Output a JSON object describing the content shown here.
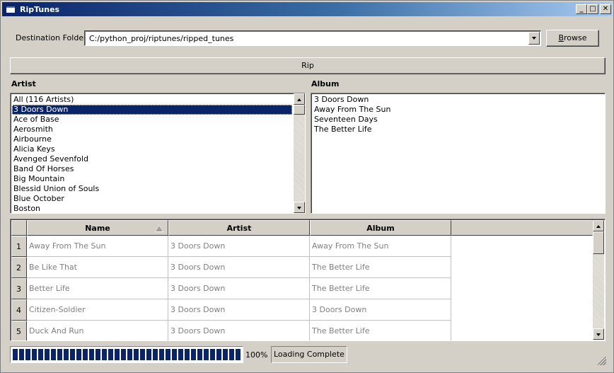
{
  "window": {
    "title": "RipTunes",
    "minimize_glyph": "_",
    "maximize_glyph": "□",
    "close_glyph": "✕"
  },
  "destination": {
    "label": "Destination Folder:",
    "value": "C:/python_proj/riptunes/ripped_tunes",
    "browse_label_prefix": "B",
    "browse_label_rest": "rowse"
  },
  "rip": {
    "label": "Rip"
  },
  "artist": {
    "label": "Artist",
    "items": [
      "All (116 Artists)",
      "3 Doors Down",
      "Ace of Base",
      "Aerosmith",
      "Airbourne",
      "Alicia Keys",
      "Avenged Sevenfold",
      "Band Of Horses",
      "Big Mountain",
      "Blessid Union of Souls",
      "Blue October",
      "Boston"
    ],
    "selected_index": 1
  },
  "album": {
    "label": "Album",
    "items": [
      "3 Doors Down",
      "Away From The Sun",
      "Seventeen Days",
      "The Better Life"
    ]
  },
  "table": {
    "columns": [
      "Name",
      "Artist",
      "Album"
    ],
    "sort_column": "Name",
    "rows": [
      {
        "num": "1",
        "name": "Away From The Sun",
        "artist": "3 Doors Down",
        "album": "Away From The Sun"
      },
      {
        "num": "2",
        "name": "Be Like That",
        "artist": "3 Doors Down",
        "album": "The Better Life"
      },
      {
        "num": "3",
        "name": "Better Life",
        "artist": "3 Doors Down",
        "album": "The Better Life"
      },
      {
        "num": "4",
        "name": "Citizen-Soldier",
        "artist": "3 Doors Down",
        "album": "3 Doors Down"
      },
      {
        "num": "5",
        "name": "Duck And Run",
        "artist": "3 Doors Down",
        "album": "The Better Life"
      }
    ]
  },
  "status": {
    "progress": 1.0,
    "progress_text": "100%",
    "message": "Loading Complete"
  },
  "colors": {
    "face": "#d4d0c8",
    "selection": "#0a246a",
    "progress": "#0a246a"
  }
}
